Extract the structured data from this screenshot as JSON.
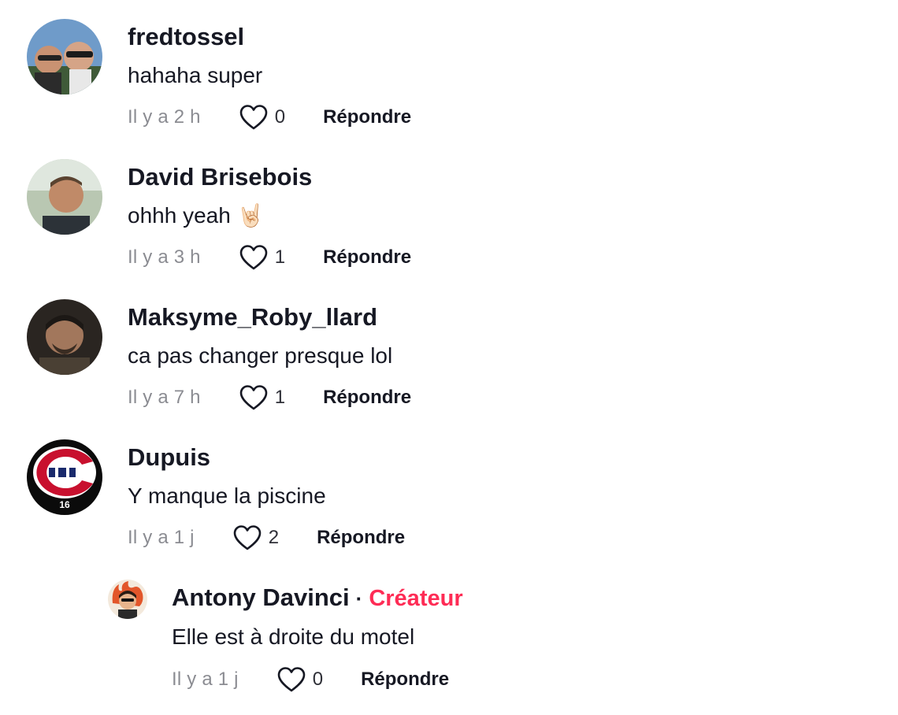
{
  "comments": [
    {
      "username": "fredtossel",
      "text": "hahaha super",
      "time": "Il y a 2 h",
      "likes": "0",
      "reply": "Répondre",
      "avatar": "user-photo"
    },
    {
      "username": "David Brisebois",
      "text": "ohhh yeah 🤘🏻",
      "time": "Il y a 3 h",
      "likes": "1",
      "reply": "Répondre",
      "avatar": "user-photo"
    },
    {
      "username": "Maksyme_Roby_llard",
      "text": "ca pas changer presque lol",
      "time": "Il y a 7 h",
      "likes": "1",
      "reply": "Répondre",
      "avatar": "user-photo"
    },
    {
      "username": "Dupuis",
      "text": "Y manque la piscine",
      "time": "Il y a 1 j",
      "likes": "2",
      "reply": "Répondre",
      "avatar": "canadiens-logo-16"
    }
  ],
  "reply_comment": {
    "username": "Antony Davinci",
    "separator": "·",
    "badge": "Créateur",
    "text": "Elle est à droite du motel",
    "time": "Il y a 1 j",
    "likes": "0",
    "reply": "Répondre",
    "avatar": "user-illustration"
  },
  "colors": {
    "creator_badge": "#fe2c55",
    "text_primary": "#161823",
    "text_secondary": "rgba(22,24,35,0.5)"
  },
  "icons": {
    "like": "heart-outline-icon"
  }
}
